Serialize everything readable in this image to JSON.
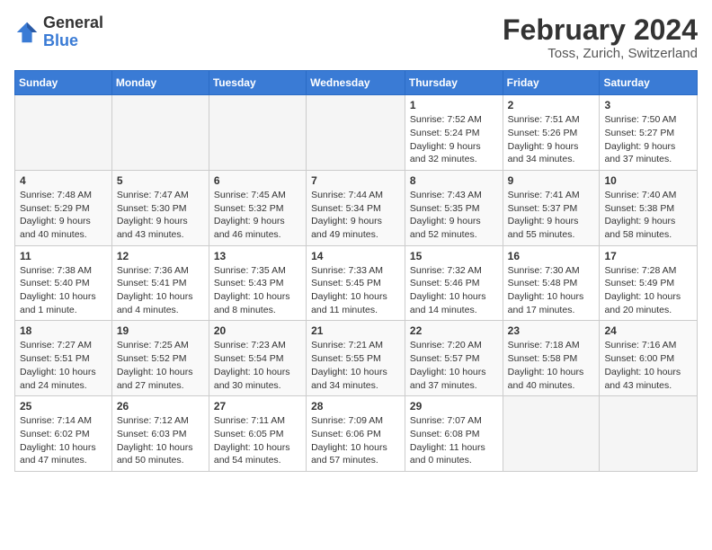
{
  "header": {
    "logo_general": "General",
    "logo_blue": "Blue",
    "month_year": "February 2024",
    "location": "Toss, Zurich, Switzerland"
  },
  "weekdays": [
    "Sunday",
    "Monday",
    "Tuesday",
    "Wednesday",
    "Thursday",
    "Friday",
    "Saturday"
  ],
  "weeks": [
    [
      {
        "day": "",
        "info": ""
      },
      {
        "day": "",
        "info": ""
      },
      {
        "day": "",
        "info": ""
      },
      {
        "day": "",
        "info": ""
      },
      {
        "day": "1",
        "info": "Sunrise: 7:52 AM\nSunset: 5:24 PM\nDaylight: 9 hours\nand 32 minutes."
      },
      {
        "day": "2",
        "info": "Sunrise: 7:51 AM\nSunset: 5:26 PM\nDaylight: 9 hours\nand 34 minutes."
      },
      {
        "day": "3",
        "info": "Sunrise: 7:50 AM\nSunset: 5:27 PM\nDaylight: 9 hours\nand 37 minutes."
      }
    ],
    [
      {
        "day": "4",
        "info": "Sunrise: 7:48 AM\nSunset: 5:29 PM\nDaylight: 9 hours\nand 40 minutes."
      },
      {
        "day": "5",
        "info": "Sunrise: 7:47 AM\nSunset: 5:30 PM\nDaylight: 9 hours\nand 43 minutes."
      },
      {
        "day": "6",
        "info": "Sunrise: 7:45 AM\nSunset: 5:32 PM\nDaylight: 9 hours\nand 46 minutes."
      },
      {
        "day": "7",
        "info": "Sunrise: 7:44 AM\nSunset: 5:34 PM\nDaylight: 9 hours\nand 49 minutes."
      },
      {
        "day": "8",
        "info": "Sunrise: 7:43 AM\nSunset: 5:35 PM\nDaylight: 9 hours\nand 52 minutes."
      },
      {
        "day": "9",
        "info": "Sunrise: 7:41 AM\nSunset: 5:37 PM\nDaylight: 9 hours\nand 55 minutes."
      },
      {
        "day": "10",
        "info": "Sunrise: 7:40 AM\nSunset: 5:38 PM\nDaylight: 9 hours\nand 58 minutes."
      }
    ],
    [
      {
        "day": "11",
        "info": "Sunrise: 7:38 AM\nSunset: 5:40 PM\nDaylight: 10 hours\nand 1 minute."
      },
      {
        "day": "12",
        "info": "Sunrise: 7:36 AM\nSunset: 5:41 PM\nDaylight: 10 hours\nand 4 minutes."
      },
      {
        "day": "13",
        "info": "Sunrise: 7:35 AM\nSunset: 5:43 PM\nDaylight: 10 hours\nand 8 minutes."
      },
      {
        "day": "14",
        "info": "Sunrise: 7:33 AM\nSunset: 5:45 PM\nDaylight: 10 hours\nand 11 minutes."
      },
      {
        "day": "15",
        "info": "Sunrise: 7:32 AM\nSunset: 5:46 PM\nDaylight: 10 hours\nand 14 minutes."
      },
      {
        "day": "16",
        "info": "Sunrise: 7:30 AM\nSunset: 5:48 PM\nDaylight: 10 hours\nand 17 minutes."
      },
      {
        "day": "17",
        "info": "Sunrise: 7:28 AM\nSunset: 5:49 PM\nDaylight: 10 hours\nand 20 minutes."
      }
    ],
    [
      {
        "day": "18",
        "info": "Sunrise: 7:27 AM\nSunset: 5:51 PM\nDaylight: 10 hours\nand 24 minutes."
      },
      {
        "day": "19",
        "info": "Sunrise: 7:25 AM\nSunset: 5:52 PM\nDaylight: 10 hours\nand 27 minutes."
      },
      {
        "day": "20",
        "info": "Sunrise: 7:23 AM\nSunset: 5:54 PM\nDaylight: 10 hours\nand 30 minutes."
      },
      {
        "day": "21",
        "info": "Sunrise: 7:21 AM\nSunset: 5:55 PM\nDaylight: 10 hours\nand 34 minutes."
      },
      {
        "day": "22",
        "info": "Sunrise: 7:20 AM\nSunset: 5:57 PM\nDaylight: 10 hours\nand 37 minutes."
      },
      {
        "day": "23",
        "info": "Sunrise: 7:18 AM\nSunset: 5:58 PM\nDaylight: 10 hours\nand 40 minutes."
      },
      {
        "day": "24",
        "info": "Sunrise: 7:16 AM\nSunset: 6:00 PM\nDaylight: 10 hours\nand 43 minutes."
      }
    ],
    [
      {
        "day": "25",
        "info": "Sunrise: 7:14 AM\nSunset: 6:02 PM\nDaylight: 10 hours\nand 47 minutes."
      },
      {
        "day": "26",
        "info": "Sunrise: 7:12 AM\nSunset: 6:03 PM\nDaylight: 10 hours\nand 50 minutes."
      },
      {
        "day": "27",
        "info": "Sunrise: 7:11 AM\nSunset: 6:05 PM\nDaylight: 10 hours\nand 54 minutes."
      },
      {
        "day": "28",
        "info": "Sunrise: 7:09 AM\nSunset: 6:06 PM\nDaylight: 10 hours\nand 57 minutes."
      },
      {
        "day": "29",
        "info": "Sunrise: 7:07 AM\nSunset: 6:08 PM\nDaylight: 11 hours\nand 0 minutes."
      },
      {
        "day": "",
        "info": ""
      },
      {
        "day": "",
        "info": ""
      }
    ]
  ]
}
